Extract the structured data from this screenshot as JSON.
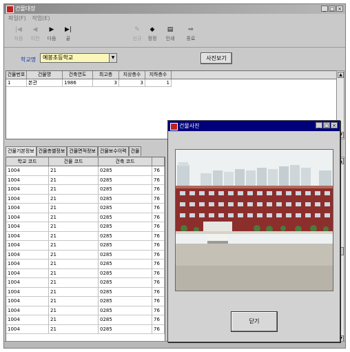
{
  "window": {
    "title": "건물대장"
  },
  "menu": [
    "파일(F)",
    "작업(E)"
  ],
  "toolbar": [
    {
      "icon": "first-record-icon",
      "glyph": "|◀",
      "label": "처음",
      "enabled": false
    },
    {
      "icon": "previous-record-icon",
      "glyph": "◀",
      "label": "이전",
      "enabled": false
    },
    {
      "icon": "next-record-icon",
      "glyph": "▶",
      "label": "다음",
      "enabled": true
    },
    {
      "icon": "last-record-icon",
      "glyph": "▶|",
      "label": "끝",
      "enabled": true
    },
    {
      "icon": "new-record-icon",
      "glyph": "✎",
      "label": "신규",
      "enabled": false
    },
    {
      "icon": "edit-record-icon",
      "glyph": "◆",
      "label": "정정",
      "enabled": true
    },
    {
      "icon": "print-icon",
      "glyph": "▤",
      "label": "인쇄",
      "enabled": true
    },
    {
      "icon": "exit-icon",
      "glyph": "⇨",
      "label": "종료",
      "enabled": true
    }
  ],
  "search": {
    "label": "학교명",
    "value": "예봉초등학교"
  },
  "photo_button": "사진보기",
  "building_grid": {
    "headers": [
      "건물번호",
      "건물명",
      "건축연도",
      "최고층",
      "지상층수",
      "지하층수"
    ],
    "rows": [
      [
        "1",
        "본관",
        "1986",
        "3",
        "3",
        "1"
      ]
    ]
  },
  "tabs": [
    "건물기본정보",
    "건물층별정보",
    "건물면적정보",
    "건물보수이력",
    "건물"
  ],
  "detail_grid": {
    "headers": [
      "학교 코드",
      "건물 코드",
      "건축 코드",
      ""
    ],
    "rows": [
      [
        "1004",
        "21",
        "0285",
        "76"
      ],
      [
        "1004",
        "21",
        "0285",
        "76"
      ],
      [
        "1004",
        "21",
        "0285",
        "76"
      ],
      [
        "1004",
        "21",
        "0285",
        "76"
      ],
      [
        "1004",
        "21",
        "0285",
        "76"
      ],
      [
        "1004",
        "21",
        "0285",
        "76"
      ],
      [
        "1004",
        "21",
        "0285",
        "76"
      ],
      [
        "1004",
        "21",
        "0285",
        "76"
      ],
      [
        "1004",
        "21",
        "0285",
        "76"
      ],
      [
        "1004",
        "21",
        "0285",
        "76"
      ],
      [
        "1004",
        "21",
        "0285",
        "76"
      ],
      [
        "1004",
        "21",
        "0285",
        "76"
      ],
      [
        "1004",
        "21",
        "0285",
        "76"
      ],
      [
        "1004",
        "21",
        "0285",
        "76"
      ],
      [
        "1004",
        "21",
        "0285",
        "76"
      ],
      [
        "1004",
        "21",
        "0285",
        "76"
      ],
      [
        "1004",
        "21",
        "0285",
        "76"
      ],
      [
        "1004",
        "21",
        "0285",
        "76"
      ]
    ]
  },
  "popup": {
    "title": "건물사진",
    "close_button": "닫기"
  },
  "colors": {
    "popup_title": "#00007a",
    "search_field": "#fbf7b8",
    "label_text": "#1a3aa8"
  }
}
